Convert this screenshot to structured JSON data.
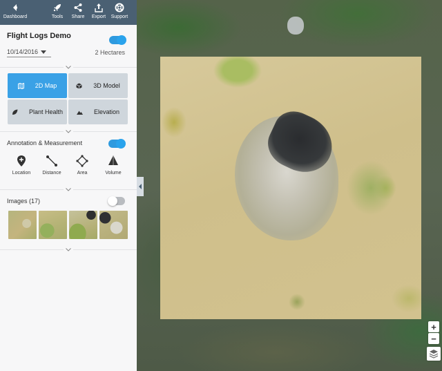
{
  "toolbar": {
    "dashboard": "Dashboard",
    "tools": "Tools",
    "share": "Share",
    "export": "Export",
    "support": "Support"
  },
  "sidebar": {
    "title": "Flight Logs Demo",
    "flight_toggle_on": true,
    "date": "10/14/2016",
    "area": "2 Hectares",
    "views": [
      {
        "label": "2D Map",
        "icon": "map-icon",
        "active": true
      },
      {
        "label": "3D Model",
        "icon": "cube-icon",
        "active": false
      },
      {
        "label": "Plant Health",
        "icon": "leaf-icon",
        "active": false
      },
      {
        "label": "Elevation",
        "icon": "mountain-icon",
        "active": false
      }
    ],
    "annotation": {
      "title": "Annotation & Measurement",
      "toggle_on": true,
      "tools": [
        {
          "label": "Location",
          "icon": "location-pin-icon"
        },
        {
          "label": "Distance",
          "icon": "distance-icon"
        },
        {
          "label": "Area",
          "icon": "area-icon"
        },
        {
          "label": "Volume",
          "icon": "volume-icon"
        }
      ]
    },
    "images": {
      "title": "Images (17)",
      "toggle_on": false,
      "thumbnail_count": 4
    }
  },
  "map": {
    "zoom_in": "+",
    "zoom_out": "−"
  },
  "colors": {
    "toolbar_bg": "#4a6073",
    "accent": "#3aa1e6",
    "inactive_button": "#cfd6dc",
    "sidebar_bg": "#f7f7f8"
  }
}
